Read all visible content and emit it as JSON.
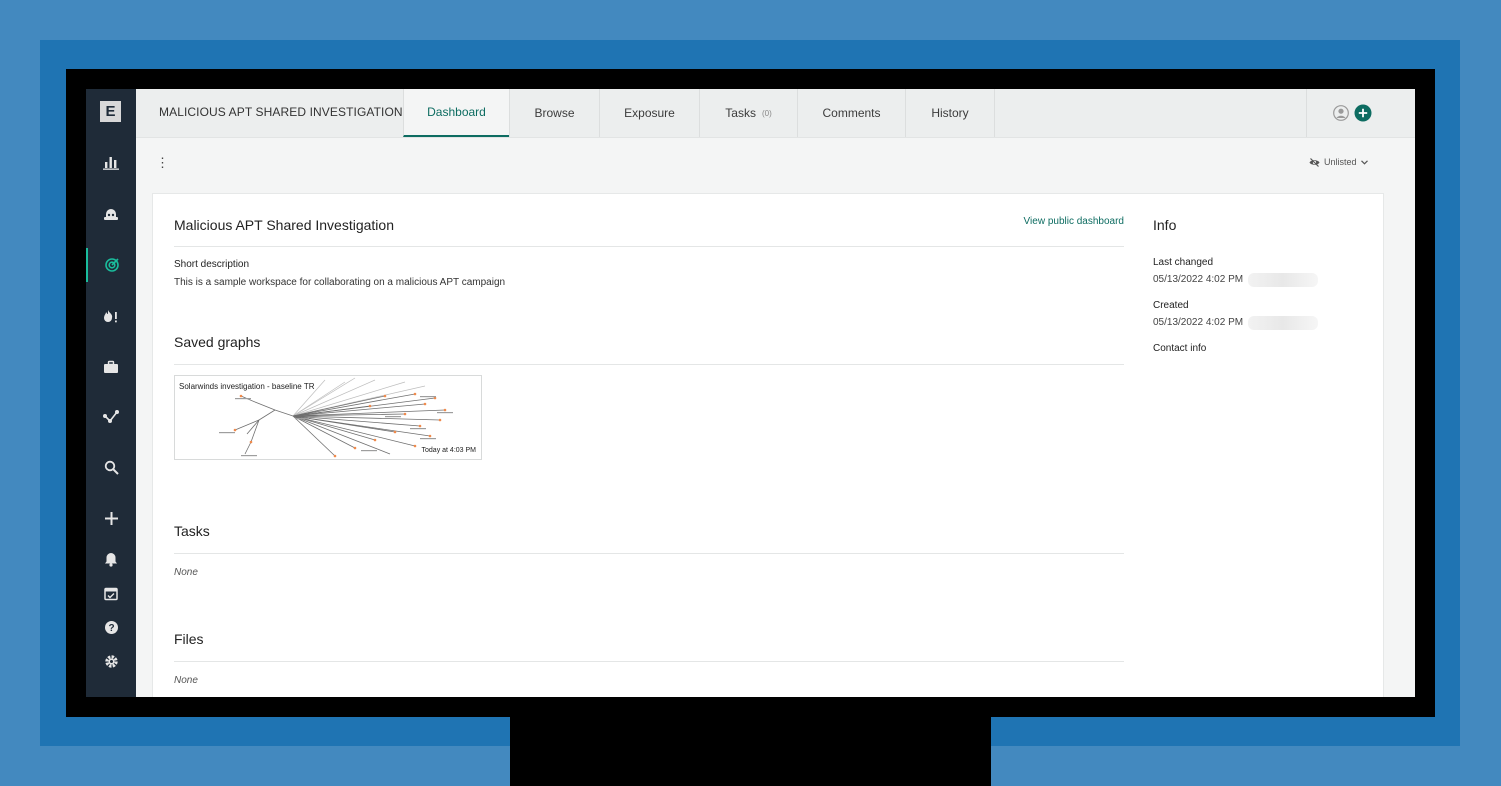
{
  "sidebar": {
    "logo": "E",
    "items": [
      {
        "icon": "bar-chart-icon"
      },
      {
        "icon": "bot-icon"
      },
      {
        "icon": "target-icon"
      },
      {
        "icon": "fire-alert-icon"
      },
      {
        "icon": "briefcase-icon"
      },
      {
        "icon": "graph-icon"
      },
      {
        "icon": "search-icon"
      },
      {
        "icon": "plus-icon"
      },
      {
        "icon": "bell-icon"
      },
      {
        "icon": "calendar-check-icon"
      },
      {
        "icon": "help-icon"
      },
      {
        "icon": "gear-icon"
      }
    ]
  },
  "header": {
    "workspace_title": "MALICIOUS APT SHARED INVESTIGATION",
    "tabs": [
      {
        "label": "Dashboard",
        "active": true
      },
      {
        "label": "Browse"
      },
      {
        "label": "Exposure"
      },
      {
        "label": "Tasks",
        "count": "(0)"
      },
      {
        "label": "Comments"
      },
      {
        "label": "History"
      }
    ]
  },
  "toolbar": {
    "visibility": "Unlisted"
  },
  "main": {
    "title": "Malicious APT Shared Investigation",
    "public_link": "View public dashboard",
    "short_description_label": "Short description",
    "short_description": "This is a sample workspace for collaborating on a malicious APT campaign",
    "saved_graphs_title": "Saved graphs",
    "graph": {
      "title": "Solarwinds investigation - baseline TR",
      "timestamp": "Today at 4:03 PM"
    },
    "tasks_title": "Tasks",
    "tasks_empty": "None",
    "files_title": "Files",
    "files_empty": "None"
  },
  "info": {
    "title": "Info",
    "last_changed_label": "Last changed",
    "last_changed_value": "05/13/2022 4:02 PM",
    "created_label": "Created",
    "created_value": "05/13/2022 4:02 PM",
    "contact_label": "Contact info"
  },
  "colors": {
    "accent": "#0d6c61",
    "sidebar_bg": "#1f2b38",
    "active_indicator": "#1abc9c",
    "backdrop": "#1f74b3"
  }
}
